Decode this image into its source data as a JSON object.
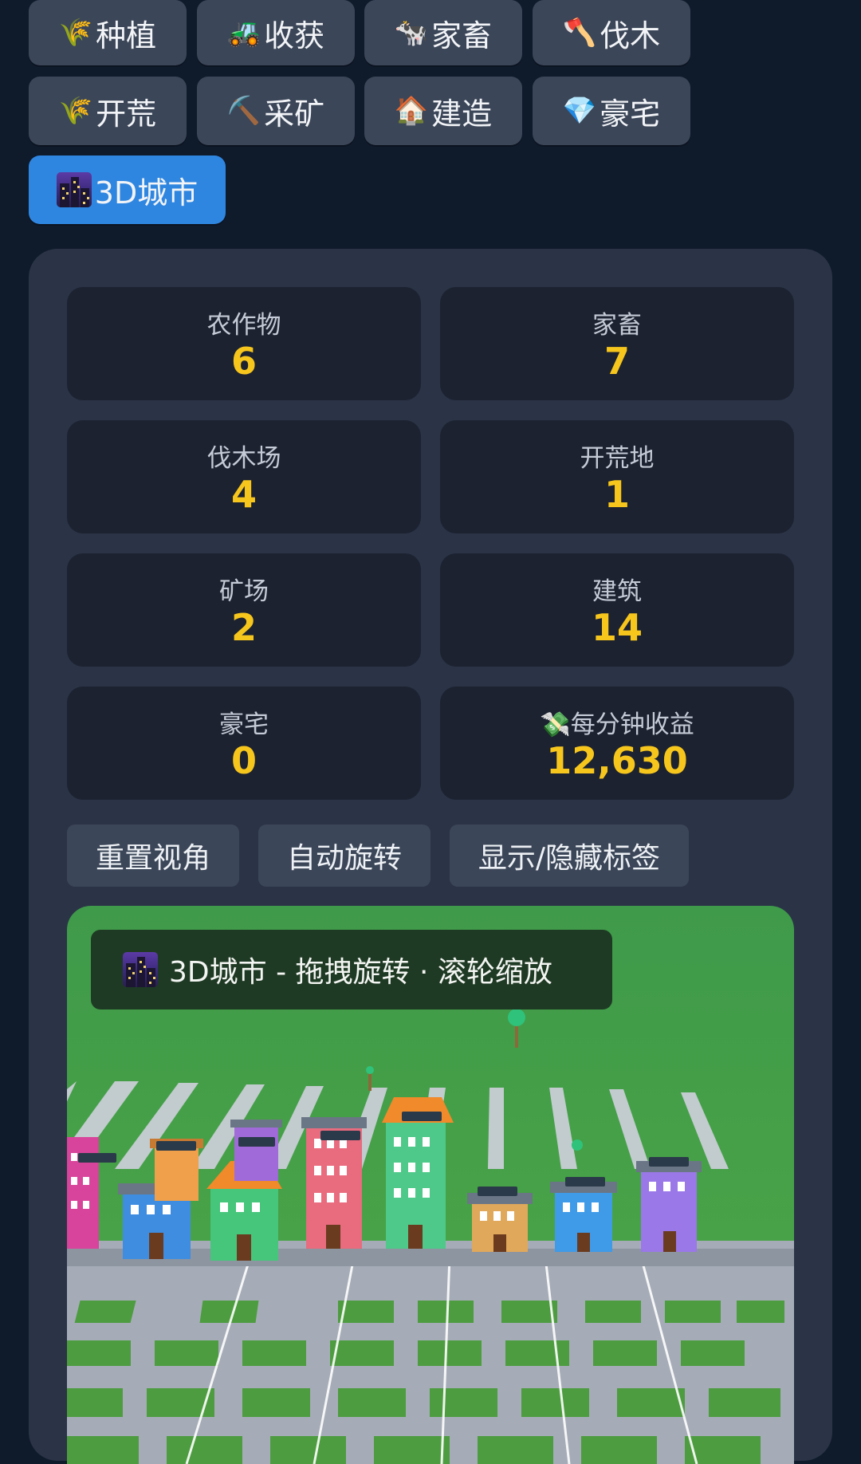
{
  "tabs": [
    {
      "icon": "🌾",
      "label": "种植"
    },
    {
      "icon": "🚜",
      "label": "收获"
    },
    {
      "icon": "🐄",
      "label": "家畜"
    },
    {
      "icon": "🪓",
      "label": "伐木"
    },
    {
      "icon": "🌾",
      "label": "开荒"
    },
    {
      "icon": "⛏️",
      "label": "采矿"
    },
    {
      "icon": "🏠",
      "label": "建造"
    },
    {
      "icon": "💎",
      "label": "豪宅"
    },
    {
      "icon": "city-night-icon",
      "label": "3D城市",
      "active": true
    }
  ],
  "stats": [
    {
      "label": "农作物",
      "value": "6"
    },
    {
      "label": "家畜",
      "value": "7"
    },
    {
      "label": "伐木场",
      "value": "4"
    },
    {
      "label": "开荒地",
      "value": "1"
    },
    {
      "label": "矿场",
      "value": "2"
    },
    {
      "label": "建筑",
      "value": "14"
    },
    {
      "label": "豪宅",
      "value": "0"
    },
    {
      "label": "💸每分钟收益",
      "value": "12,630"
    }
  ],
  "controls": {
    "reset_view": "重置视角",
    "auto_rotate": "自动旋转",
    "toggle_labels": "显示/隐藏标签"
  },
  "scene": {
    "overlay_text": "3D城市 - 拖拽旋转 · 滚轮缩放"
  },
  "colors": {
    "accent": "#2f86e0",
    "value": "#f7c61d",
    "grass": "#4a9a3e"
  }
}
